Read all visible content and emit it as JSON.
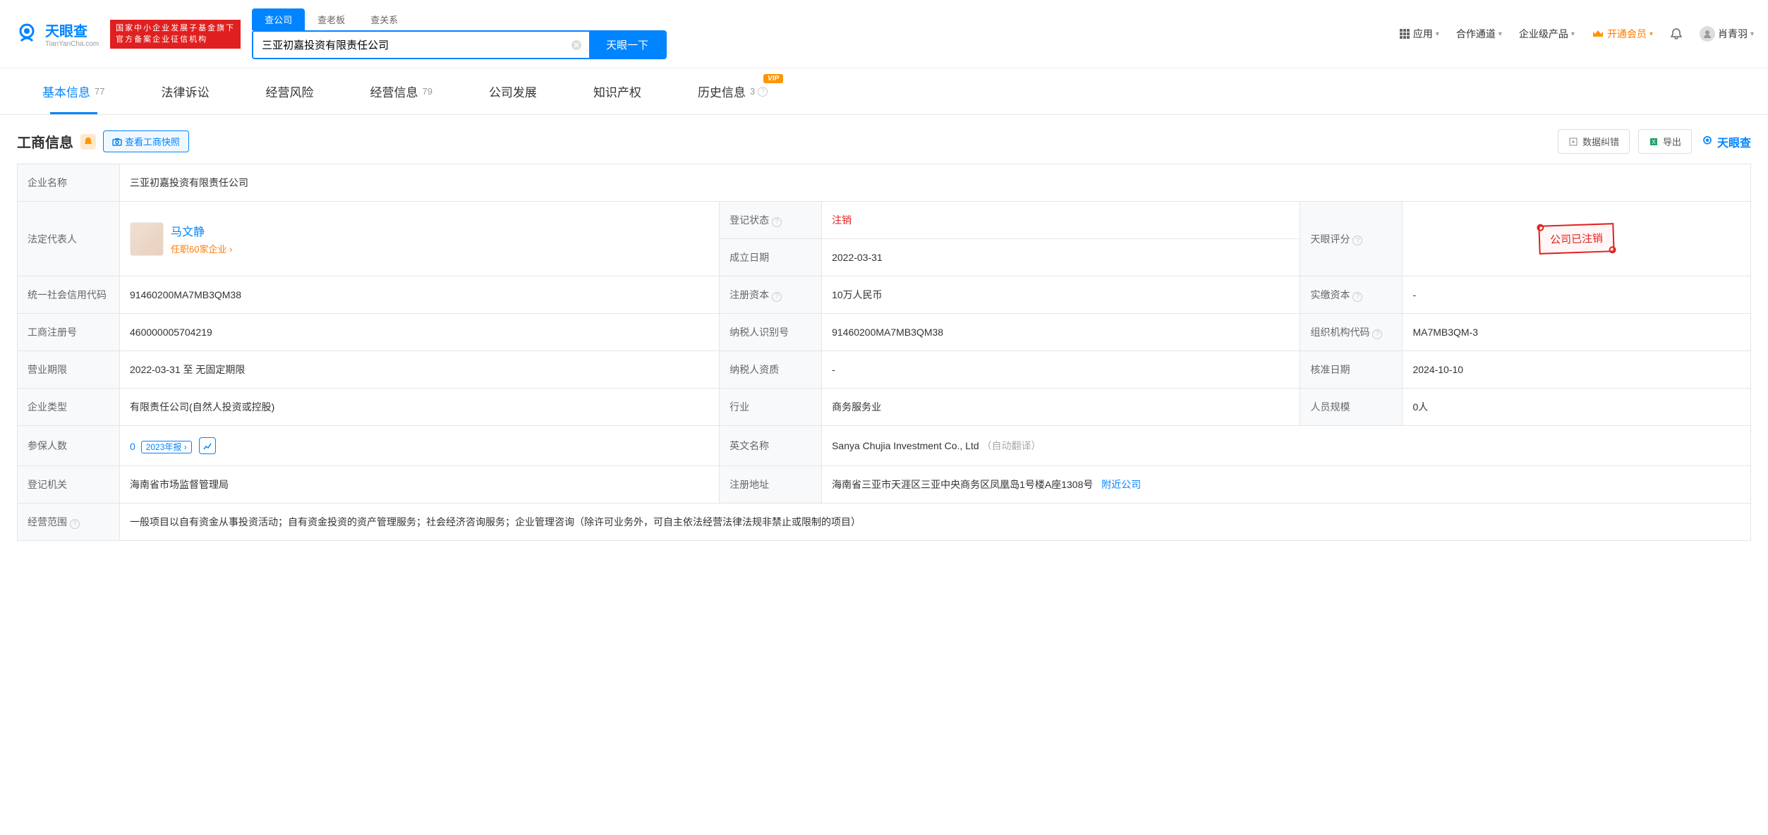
{
  "header": {
    "logo_cn": "天眼查",
    "logo_en": "TianYanCha.com",
    "red_badge_l1": "国家中小企业发展子基金旗下",
    "red_badge_l2": "官方备案企业征信机构",
    "search_tabs": [
      "查公司",
      "查老板",
      "查关系"
    ],
    "search_value": "三亚初嘉投资有限责任公司",
    "search_btn": "天眼一下",
    "nav": {
      "app": "应用",
      "coop": "合作通道",
      "enterprise": "企业级产品",
      "vip": "开通会员",
      "user": "肖青羽"
    }
  },
  "tabs": [
    {
      "label": "基本信息",
      "count": "77",
      "active": true
    },
    {
      "label": "法律诉讼"
    },
    {
      "label": "经营风险"
    },
    {
      "label": "经营信息",
      "count": "79"
    },
    {
      "label": "公司发展"
    },
    {
      "label": "知识产权"
    },
    {
      "label": "历史信息",
      "count": "3",
      "vip": true
    }
  ],
  "section": {
    "title": "工商信息",
    "snapshot_btn": "查看工商快照",
    "correction_btn": "数据纠错",
    "export_btn": "导出",
    "watermark": "天眼查"
  },
  "info": {
    "company_name_label": "企业名称",
    "company_name": "三亚初嘉投资有限责任公司",
    "legal_rep_label": "法定代表人",
    "legal_rep_name": "马文静",
    "legal_rep_sub": "任职60家企业 ›",
    "reg_status_label": "登记状态",
    "reg_status": "注销",
    "est_date_label": "成立日期",
    "est_date": "2022-03-31",
    "score_label": "天眼评分",
    "score_stamp": "公司已注销",
    "credit_code_label": "统一社会信用代码",
    "credit_code": "91460200MA7MB3QM38",
    "reg_capital_label": "注册资本",
    "reg_capital": "10万人民币",
    "paid_capital_label": "实缴资本",
    "paid_capital": "-",
    "reg_no_label": "工商注册号",
    "reg_no": "460000005704219",
    "tax_id_label": "纳税人识别号",
    "tax_id": "91460200MA7MB3QM38",
    "org_code_label": "组织机构代码",
    "org_code": "MA7MB3QM-3",
    "term_label": "营业期限",
    "term": "2022-03-31 至 无固定期限",
    "tax_qual_label": "纳税人资质",
    "tax_qual": "-",
    "approve_date_label": "核准日期",
    "approve_date": "2024-10-10",
    "type_label": "企业类型",
    "type": "有限责任公司(自然人投资或控股)",
    "industry_label": "行业",
    "industry": "商务服务业",
    "staff_label": "人员规模",
    "staff": "0人",
    "insured_label": "参保人数",
    "insured": "0",
    "insured_year": "2023年报 ›",
    "en_name_label": "英文名称",
    "en_name": "Sanya Chujia Investment Co., Ltd",
    "en_name_note": "（自动翻译）",
    "authority_label": "登记机关",
    "authority": "海南省市场监督管理局",
    "address_label": "注册地址",
    "address": "海南省三亚市天涯区三亚中央商务区凤凰岛1号楼A座1308号",
    "nearby": "附近公司",
    "scope_label": "经营范围",
    "scope": "一般项目以自有资金从事投资活动；自有资金投资的资产管理服务；社会经济咨询服务；企业管理咨询（除许可业务外，可自主依法经营法律法规非禁止或限制的项目）"
  },
  "vip_label": "VIP"
}
